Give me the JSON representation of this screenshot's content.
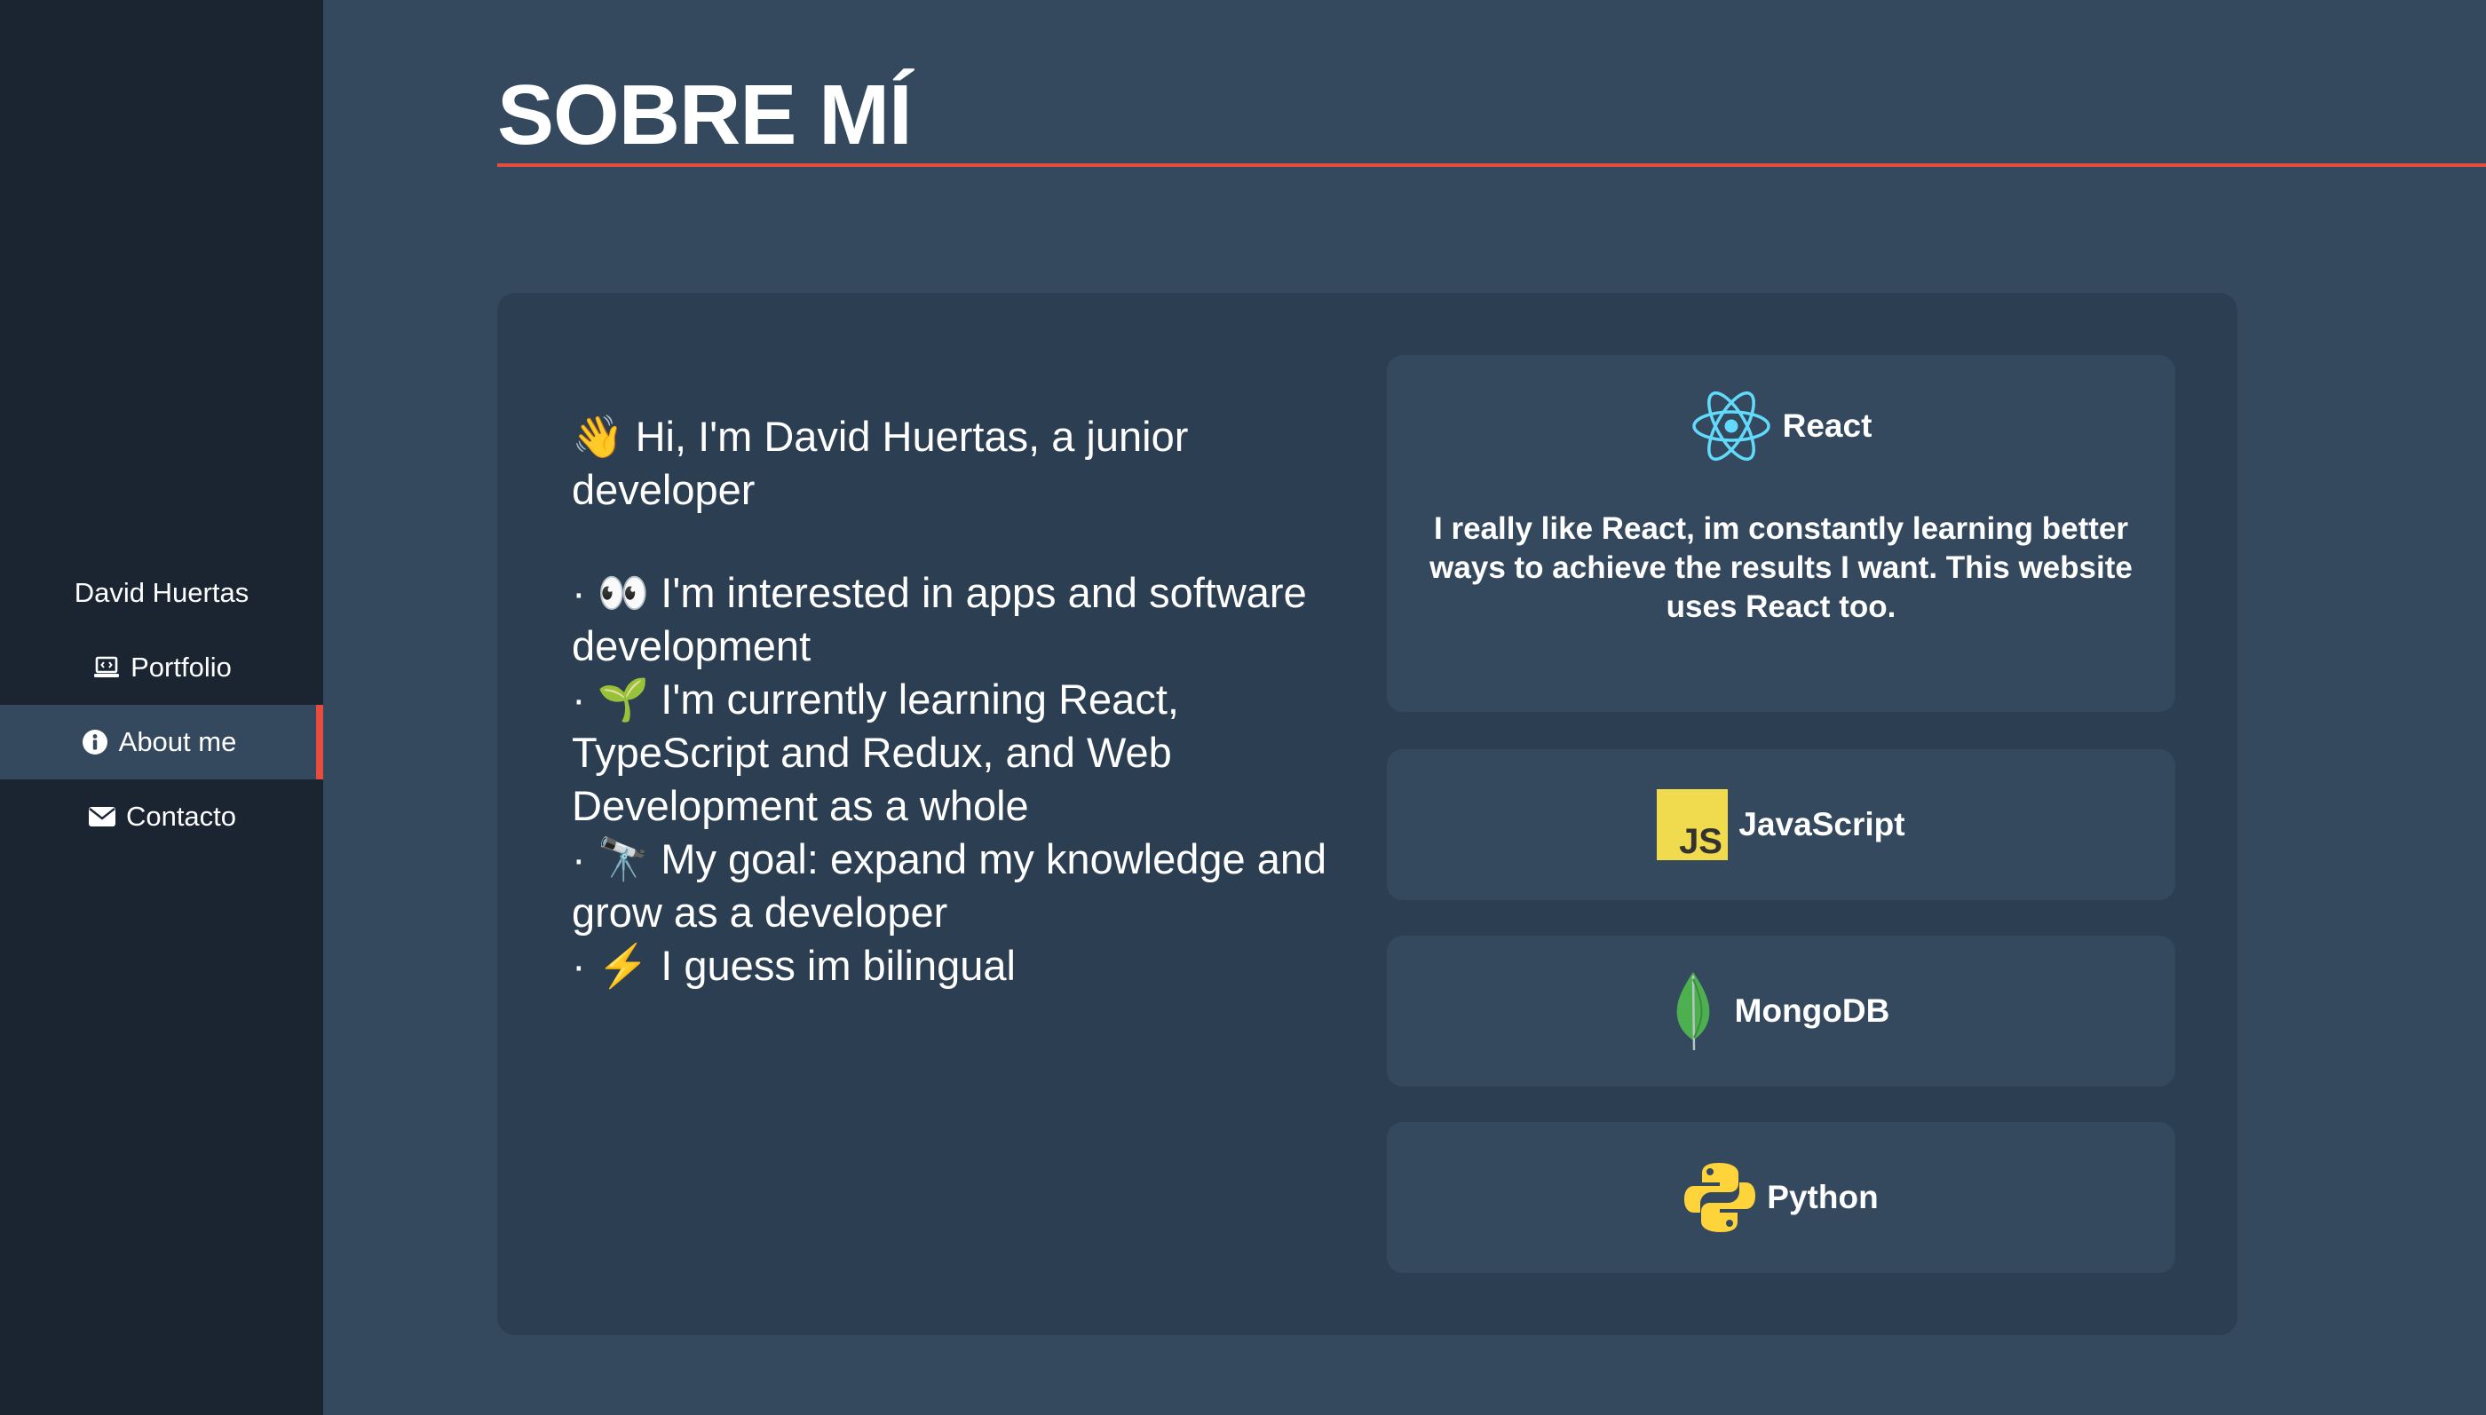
{
  "sidebar": {
    "brand": "David Huertas",
    "items": [
      {
        "label": "Portfolio",
        "icon": "laptop-code-icon"
      },
      {
        "label": "About me",
        "icon": "info-circle-icon",
        "active": true
      },
      {
        "label": "Contacto",
        "icon": "envelope-icon"
      }
    ]
  },
  "header": {
    "title": "SOBRE MÍ"
  },
  "intro": {
    "greeting": "👋 Hi, I'm David Huertas, a junior developer",
    "lines": [
      "· 👀 I'm interested in apps and software development",
      "· 🌱 I'm currently learning React, TypeScript and Redux, and Web Development as a whole",
      "· 🔭 My goal: expand my knowledge and grow as a developer",
      "· ⚡ I guess im bilingual"
    ]
  },
  "skills": [
    {
      "name": "React",
      "icon": "react-icon",
      "description": "I really like React, im constantly learning better ways to achieve the results I want. This website uses React too."
    },
    {
      "name": "JavaScript",
      "icon": "javascript-icon"
    },
    {
      "name": "MongoDB",
      "icon": "mongodb-icon"
    },
    {
      "name": "Python",
      "icon": "python-icon"
    }
  ],
  "colors": {
    "sidebar_bg": "#1b2532",
    "page_bg": "#34495e",
    "card_bg": "#2c3e52",
    "accent": "#e74c3c",
    "react": "#61dafb",
    "javascript": "#f0db4f",
    "mongodb": "#4caf50",
    "python_blue": "#3776ab",
    "python_yellow": "#ffd43b"
  }
}
